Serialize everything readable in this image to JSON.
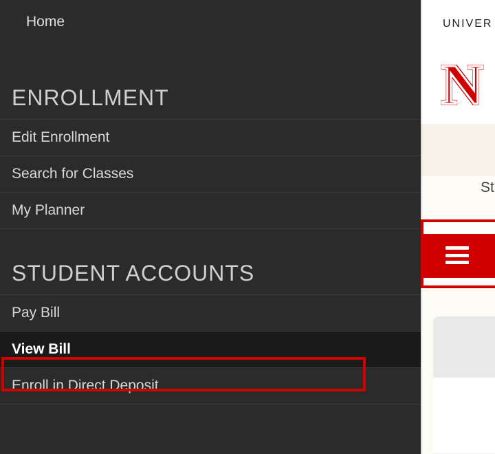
{
  "sidebar": {
    "home_label": "Home",
    "sections": [
      {
        "header": "ENROLLMENT",
        "items": [
          {
            "label": "Edit Enrollment"
          },
          {
            "label": "Search for Classes"
          },
          {
            "label": "My Planner"
          }
        ]
      },
      {
        "header": "STUDENT ACCOUNTS",
        "items": [
          {
            "label": "Pay Bill"
          },
          {
            "label": "View Bill"
          },
          {
            "label": "Enroll in Direct Deposit"
          }
        ]
      }
    ]
  },
  "right": {
    "univ_label_partial": "UNIVER",
    "logo_letter": "N",
    "st_partial": "St"
  }
}
